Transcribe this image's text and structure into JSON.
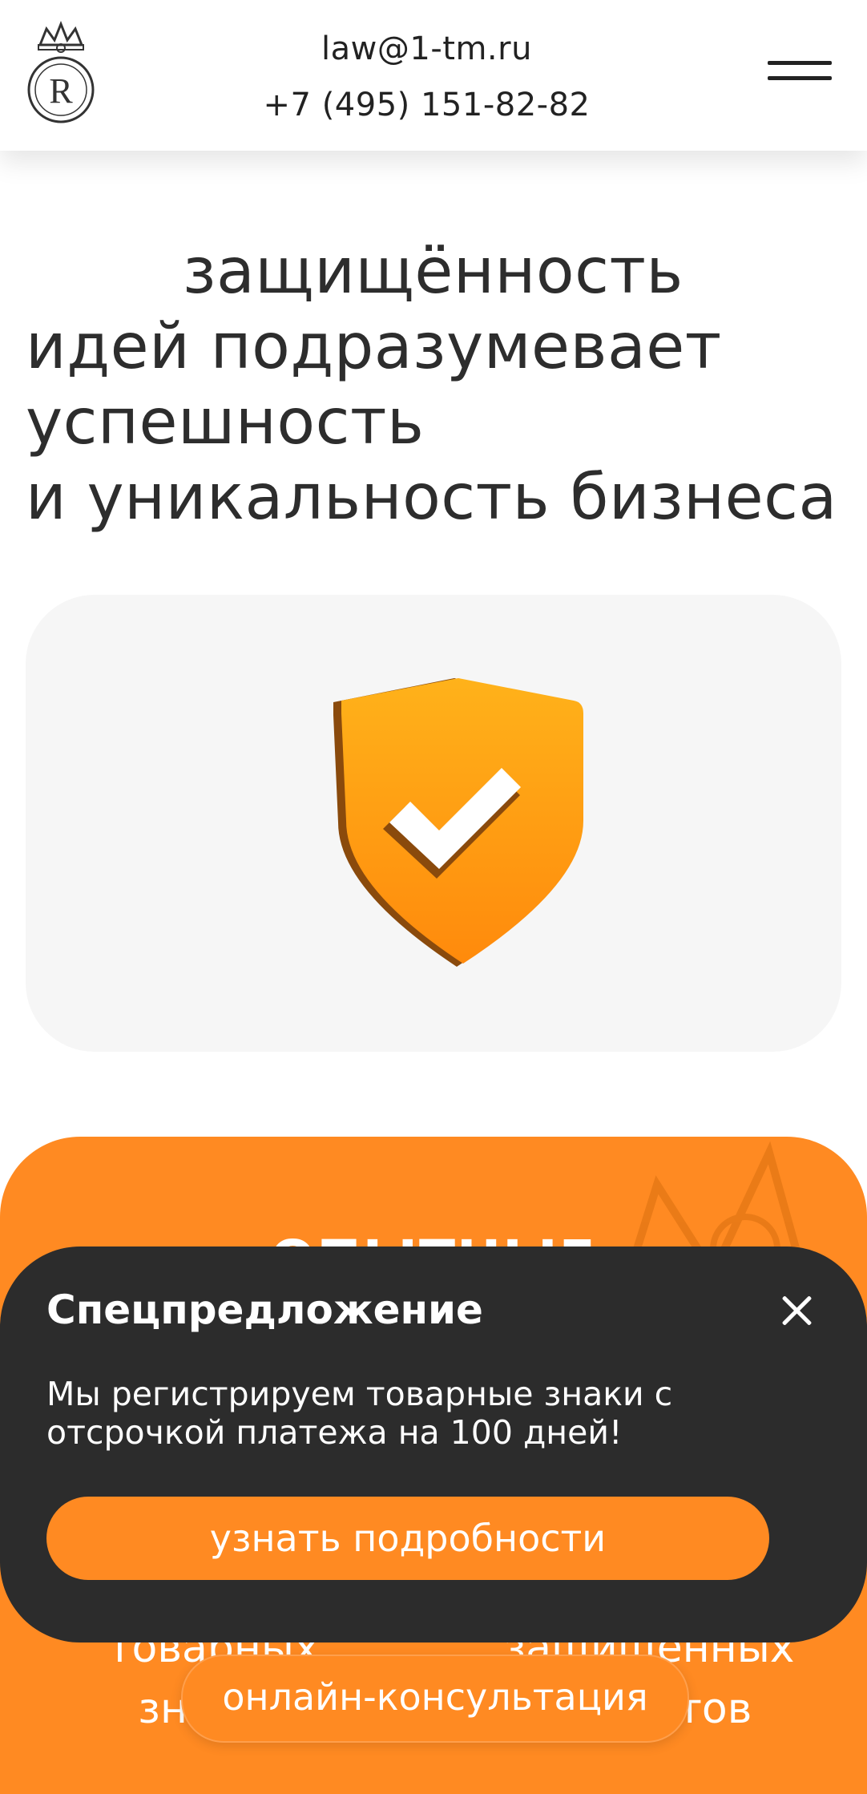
{
  "header": {
    "logo_icon": "royal-crown-R-logo-icon",
    "email": "law@1-tm.ru",
    "phone": "+7 (495) 151-82-82",
    "menu_icon": "hamburger-menu-icon"
  },
  "hero": {
    "title_line1": "защищённость",
    "title_rest": "идей подразумевает\nуспешность\nи уникальность бизнеса"
  },
  "shield_card": {
    "icon": "shield-check-icon",
    "colors": {
      "shield": "#ffa313",
      "check": "#ffffff",
      "card_bg": "#f6f6f6"
    }
  },
  "stats": {
    "heading_partial": "ОПЫТНЫЕ",
    "left_label": "товарных знаков",
    "right_label": "защищенных объектов"
  },
  "promo": {
    "title": "Спецпредложение",
    "text": "Мы регистрируем товарные знаки с отсрочкой платежа на 100 дней!",
    "button": "узнать подробности",
    "close_icon": "close-icon"
  },
  "consult_button": "онлайн-консультация",
  "colors": {
    "accent": "#ff8a22",
    "popup_bg": "#2c2c2c",
    "text": "#2d2d2d"
  }
}
